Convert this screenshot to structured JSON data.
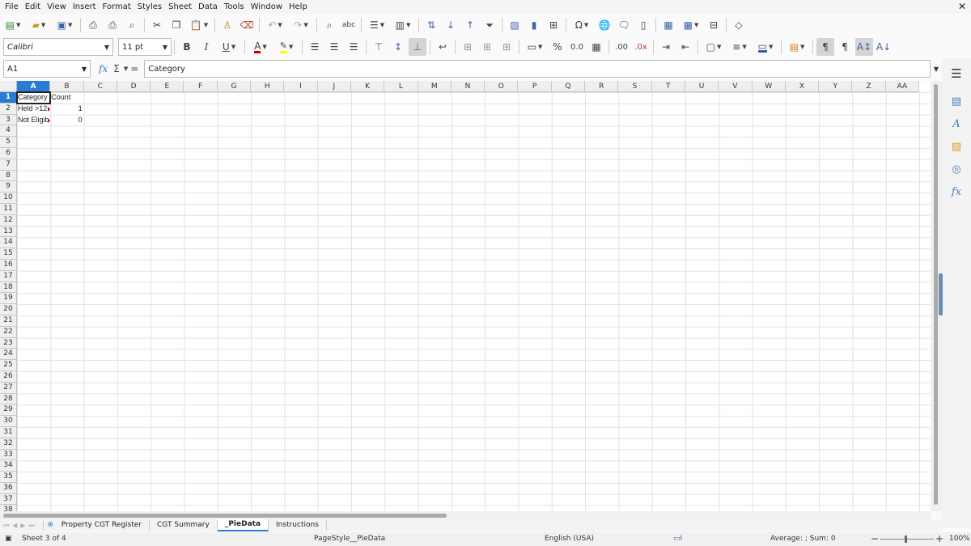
{
  "menubar": {
    "items": [
      "File",
      "Edit",
      "View",
      "Insert",
      "Format",
      "Styles",
      "Sheet",
      "Data",
      "Tools",
      "Window",
      "Help"
    ]
  },
  "toolbar2": {
    "font_name": "Calibri",
    "font_size": "11 pt",
    "bold_label": "B",
    "italic_label": "I",
    "underline_label": "U",
    "font_color": "#c00000",
    "highlight_color": "#ffff00",
    "border_color": "#2a60b0"
  },
  "formula_bar": {
    "name_box": "A1",
    "content": "Category"
  },
  "grid": {
    "columns": [
      "A",
      "B",
      "C",
      "D",
      "E",
      "F",
      "G",
      "H",
      "I",
      "J",
      "K",
      "L",
      "M",
      "N",
      "O",
      "P",
      "Q",
      "R",
      "S",
      "T",
      "U",
      "V",
      "W",
      "X",
      "Y",
      "Z",
      "AA"
    ],
    "rows": [
      "1",
      "2",
      "3",
      "4",
      "5",
      "6",
      "7",
      "8",
      "9",
      "10",
      "11",
      "12",
      "13",
      "14",
      "15",
      "16",
      "17",
      "18",
      "19",
      "20",
      "21",
      "22",
      "23",
      "24",
      "25",
      "26",
      "27",
      "28",
      "29",
      "30",
      "31",
      "32",
      "33",
      "34",
      "35",
      "36",
      "37",
      "38"
    ],
    "cells": {
      "A1": "Category",
      "B1": "Count",
      "A2": "Held >12",
      "B2": "1",
      "A3": "Not Eligib",
      "B3": "0"
    },
    "selected_column": "A",
    "selected_row": "1"
  },
  "sheet_tabs": {
    "tabs": [
      "Property CGT Register",
      "CGT Summary",
      "_PieData",
      "Instructions"
    ],
    "active": "_PieData"
  },
  "statusbar": {
    "sheet_info": "Sheet 3 of 4",
    "page_style": "PageStyle__PieData",
    "language": "English (USA)",
    "summary": "Average: ; Sum: 0",
    "zoom": "100%"
  }
}
